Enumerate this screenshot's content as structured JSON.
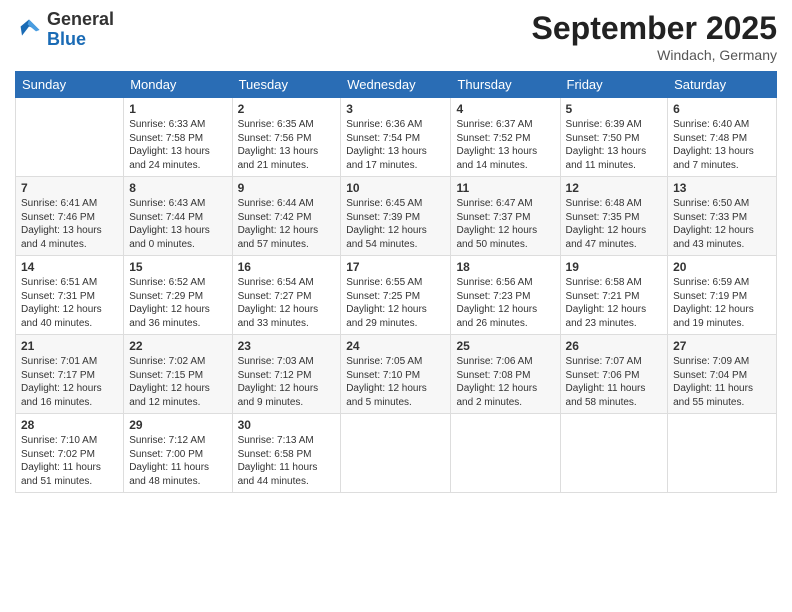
{
  "logo": {
    "general": "General",
    "blue": "Blue"
  },
  "header": {
    "month": "September 2025",
    "location": "Windach, Germany"
  },
  "weekdays": [
    "Sunday",
    "Monday",
    "Tuesday",
    "Wednesday",
    "Thursday",
    "Friday",
    "Saturday"
  ],
  "weeks": [
    [
      {
        "day": "",
        "info": ""
      },
      {
        "day": "1",
        "info": "Sunrise: 6:33 AM\nSunset: 7:58 PM\nDaylight: 13 hours\nand 24 minutes."
      },
      {
        "day": "2",
        "info": "Sunrise: 6:35 AM\nSunset: 7:56 PM\nDaylight: 13 hours\nand 21 minutes."
      },
      {
        "day": "3",
        "info": "Sunrise: 6:36 AM\nSunset: 7:54 PM\nDaylight: 13 hours\nand 17 minutes."
      },
      {
        "day": "4",
        "info": "Sunrise: 6:37 AM\nSunset: 7:52 PM\nDaylight: 13 hours\nand 14 minutes."
      },
      {
        "day": "5",
        "info": "Sunrise: 6:39 AM\nSunset: 7:50 PM\nDaylight: 13 hours\nand 11 minutes."
      },
      {
        "day": "6",
        "info": "Sunrise: 6:40 AM\nSunset: 7:48 PM\nDaylight: 13 hours\nand 7 minutes."
      }
    ],
    [
      {
        "day": "7",
        "info": "Sunrise: 6:41 AM\nSunset: 7:46 PM\nDaylight: 13 hours\nand 4 minutes."
      },
      {
        "day": "8",
        "info": "Sunrise: 6:43 AM\nSunset: 7:44 PM\nDaylight: 13 hours\nand 0 minutes."
      },
      {
        "day": "9",
        "info": "Sunrise: 6:44 AM\nSunset: 7:42 PM\nDaylight: 12 hours\nand 57 minutes."
      },
      {
        "day": "10",
        "info": "Sunrise: 6:45 AM\nSunset: 7:39 PM\nDaylight: 12 hours\nand 54 minutes."
      },
      {
        "day": "11",
        "info": "Sunrise: 6:47 AM\nSunset: 7:37 PM\nDaylight: 12 hours\nand 50 minutes."
      },
      {
        "day": "12",
        "info": "Sunrise: 6:48 AM\nSunset: 7:35 PM\nDaylight: 12 hours\nand 47 minutes."
      },
      {
        "day": "13",
        "info": "Sunrise: 6:50 AM\nSunset: 7:33 PM\nDaylight: 12 hours\nand 43 minutes."
      }
    ],
    [
      {
        "day": "14",
        "info": "Sunrise: 6:51 AM\nSunset: 7:31 PM\nDaylight: 12 hours\nand 40 minutes."
      },
      {
        "day": "15",
        "info": "Sunrise: 6:52 AM\nSunset: 7:29 PM\nDaylight: 12 hours\nand 36 minutes."
      },
      {
        "day": "16",
        "info": "Sunrise: 6:54 AM\nSunset: 7:27 PM\nDaylight: 12 hours\nand 33 minutes."
      },
      {
        "day": "17",
        "info": "Sunrise: 6:55 AM\nSunset: 7:25 PM\nDaylight: 12 hours\nand 29 minutes."
      },
      {
        "day": "18",
        "info": "Sunrise: 6:56 AM\nSunset: 7:23 PM\nDaylight: 12 hours\nand 26 minutes."
      },
      {
        "day": "19",
        "info": "Sunrise: 6:58 AM\nSunset: 7:21 PM\nDaylight: 12 hours\nand 23 minutes."
      },
      {
        "day": "20",
        "info": "Sunrise: 6:59 AM\nSunset: 7:19 PM\nDaylight: 12 hours\nand 19 minutes."
      }
    ],
    [
      {
        "day": "21",
        "info": "Sunrise: 7:01 AM\nSunset: 7:17 PM\nDaylight: 12 hours\nand 16 minutes."
      },
      {
        "day": "22",
        "info": "Sunrise: 7:02 AM\nSunset: 7:15 PM\nDaylight: 12 hours\nand 12 minutes."
      },
      {
        "day": "23",
        "info": "Sunrise: 7:03 AM\nSunset: 7:12 PM\nDaylight: 12 hours\nand 9 minutes."
      },
      {
        "day": "24",
        "info": "Sunrise: 7:05 AM\nSunset: 7:10 PM\nDaylight: 12 hours\nand 5 minutes."
      },
      {
        "day": "25",
        "info": "Sunrise: 7:06 AM\nSunset: 7:08 PM\nDaylight: 12 hours\nand 2 minutes."
      },
      {
        "day": "26",
        "info": "Sunrise: 7:07 AM\nSunset: 7:06 PM\nDaylight: 11 hours\nand 58 minutes."
      },
      {
        "day": "27",
        "info": "Sunrise: 7:09 AM\nSunset: 7:04 PM\nDaylight: 11 hours\nand 55 minutes."
      }
    ],
    [
      {
        "day": "28",
        "info": "Sunrise: 7:10 AM\nSunset: 7:02 PM\nDaylight: 11 hours\nand 51 minutes."
      },
      {
        "day": "29",
        "info": "Sunrise: 7:12 AM\nSunset: 7:00 PM\nDaylight: 11 hours\nand 48 minutes."
      },
      {
        "day": "30",
        "info": "Sunrise: 7:13 AM\nSunset: 6:58 PM\nDaylight: 11 hours\nand 44 minutes."
      },
      {
        "day": "",
        "info": ""
      },
      {
        "day": "",
        "info": ""
      },
      {
        "day": "",
        "info": ""
      },
      {
        "day": "",
        "info": ""
      }
    ]
  ]
}
